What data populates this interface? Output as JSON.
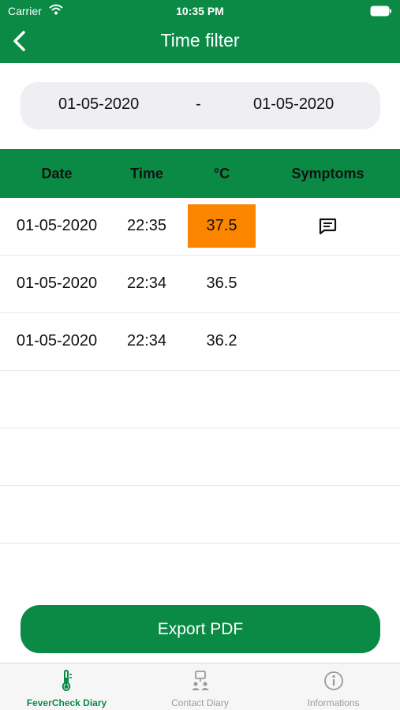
{
  "status_bar": {
    "carrier": "Carrier",
    "time": "10:35 PM"
  },
  "header": {
    "title": "Time filter",
    "back_icon": "chevron-left-icon"
  },
  "date_range": {
    "from": "01-05-2020",
    "separator": "-",
    "to": "01-05-2020"
  },
  "table": {
    "columns": [
      "Date",
      "Time",
      "°C",
      "Symptoms"
    ],
    "rows": [
      {
        "date": "01-05-2020",
        "time": "22:35",
        "temp": "37.5",
        "fever": true,
        "has_symptoms": true
      },
      {
        "date": "01-05-2020",
        "time": "22:34",
        "temp": "36.5",
        "fever": false,
        "has_symptoms": false
      },
      {
        "date": "01-05-2020",
        "time": "22:34",
        "temp": "36.2",
        "fever": false,
        "has_symptoms": false
      }
    ],
    "fever_color": "#fc8500",
    "symptoms_icon": "message-icon"
  },
  "export_button": {
    "label": "Export PDF"
  },
  "tabbar": {
    "tabs": [
      {
        "label": "FeverCheck Diary",
        "icon": "thermometer-icon",
        "active": true
      },
      {
        "label": "Contact Diary",
        "icon": "people-icon",
        "active": false
      },
      {
        "label": "Informations",
        "icon": "info-icon",
        "active": false
      }
    ]
  },
  "colors": {
    "primary": "#0a8a45",
    "fever": "#fc8500"
  }
}
